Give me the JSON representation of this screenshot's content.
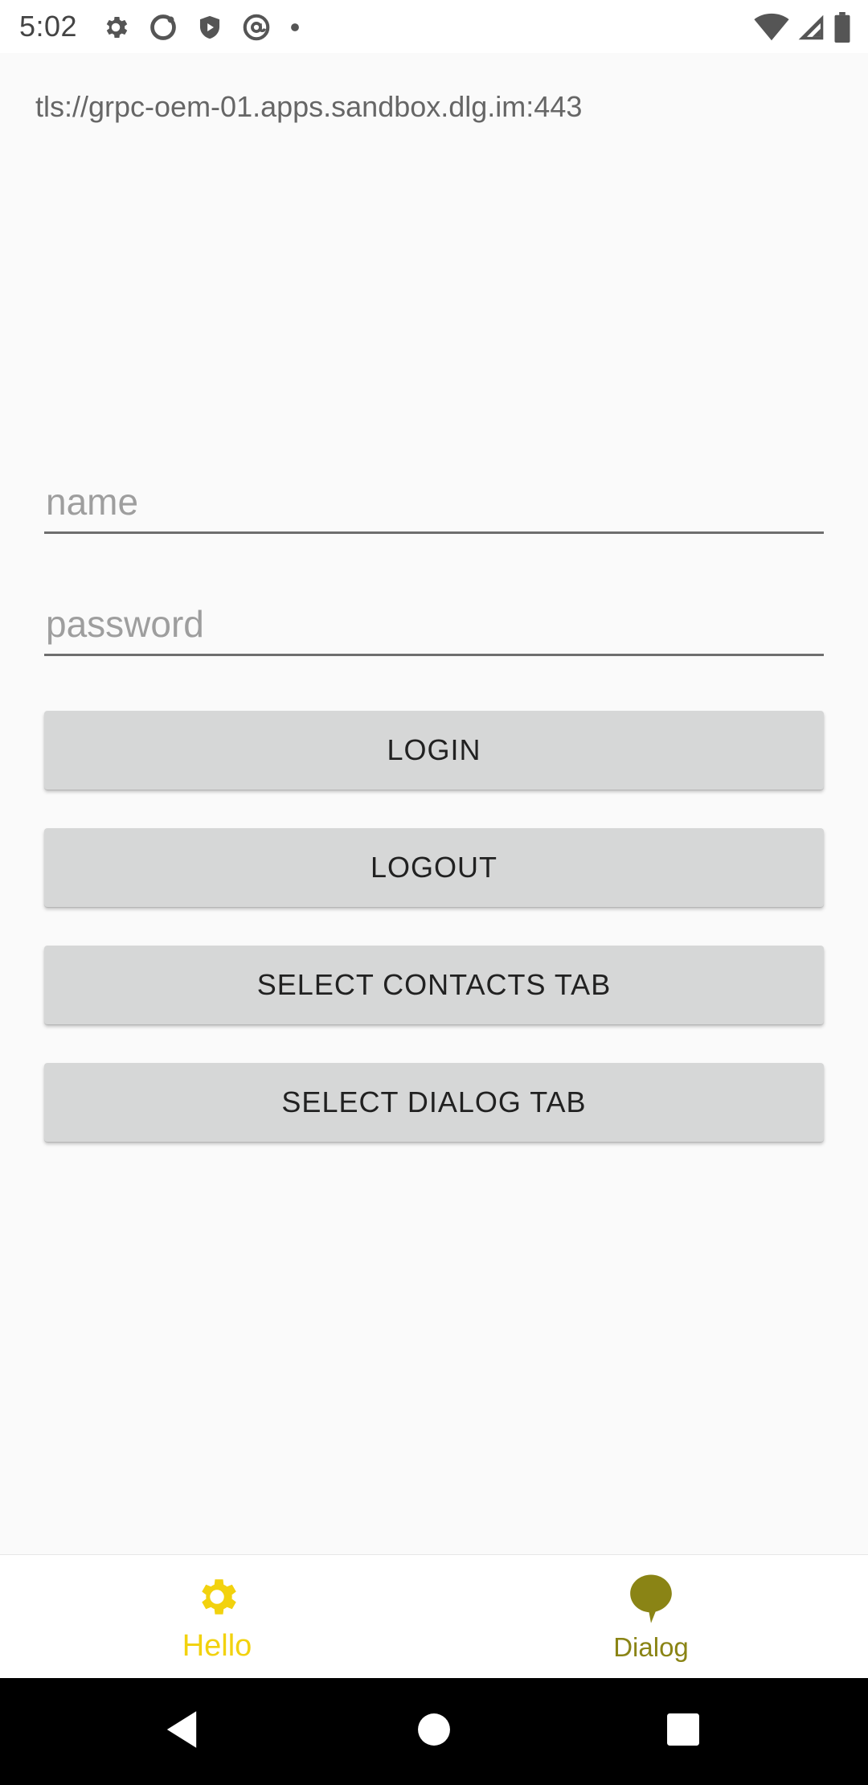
{
  "status_bar": {
    "time": "5:02",
    "icons_left": [
      "settings-icon",
      "sync-ring-icon",
      "shield-play-icon",
      "at-sign-icon",
      "dot-icon"
    ],
    "icons_right": [
      "wifi-icon",
      "cell-signal-icon",
      "battery-icon"
    ]
  },
  "server": {
    "url": "tls://grpc-oem-01.apps.sandbox.dlg.im:443"
  },
  "form": {
    "name_placeholder": "name",
    "name_value": "",
    "password_placeholder": "password",
    "password_value": ""
  },
  "buttons": {
    "login": "LOGIN",
    "logout": "LOGOUT",
    "select_contacts_tab": "SELECT CONTACTS TAB",
    "select_dialog_tab": "SELECT DIALOG TAB"
  },
  "bottom_nav": {
    "items": [
      {
        "label": "Hello",
        "icon": "gear-icon",
        "selected": true,
        "color": "#f2d20e"
      },
      {
        "label": "Dialog",
        "icon": "chat-bubble-icon",
        "selected": false,
        "color": "#8a8415"
      }
    ]
  },
  "system_nav": {
    "buttons": [
      "back-icon",
      "home-icon",
      "recents-icon"
    ]
  },
  "colors": {
    "accent_selected": "#f2d20e",
    "accent_unselected": "#8a8415",
    "button_bg": "#d6d7d7",
    "background": "#fafafa"
  }
}
